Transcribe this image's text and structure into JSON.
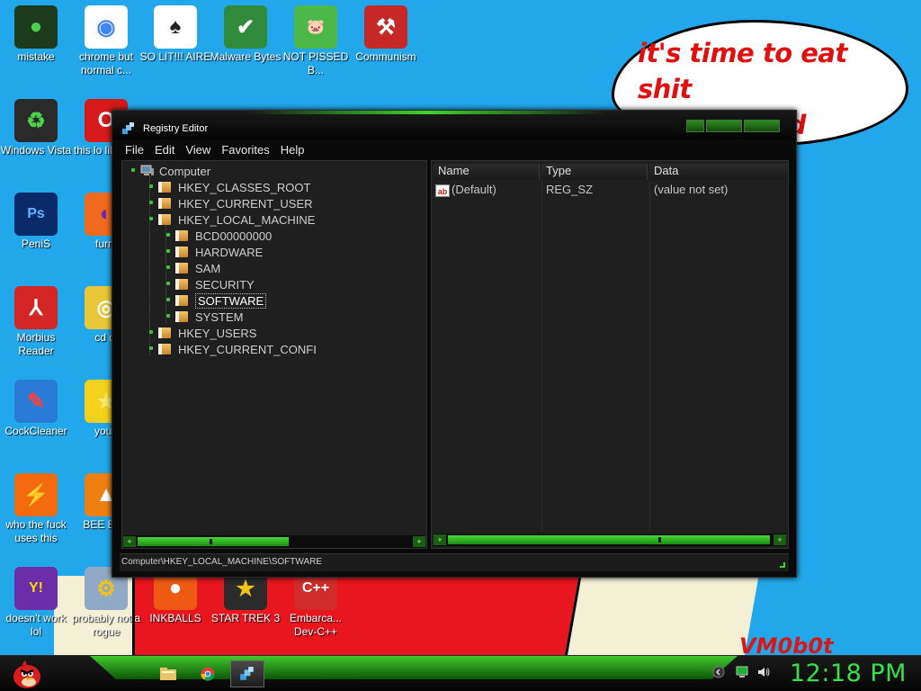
{
  "wallpaper": {
    "speech_bubble": [
      "it's time to eat shit",
      "and die and chew"
    ],
    "watermark": "VM0b0t"
  },
  "desktop_icons": [
    {
      "label": "mistake",
      "icon": "green-orb-icon"
    },
    {
      "label": "chrome but normal c...",
      "icon": "chrome-icon"
    },
    {
      "label": "SO LIT!!! AIRE",
      "icon": "playing-cards-icon"
    },
    {
      "label": "Malware Bytes",
      "icon": "shield-check-icon"
    },
    {
      "label": "NOT PISSED B...",
      "icon": "angry-bird-pig-icon"
    },
    {
      "label": "Communism",
      "icon": "emblem-icon"
    },
    {
      "label": "Windows Vista",
      "icon": "recycle-icon"
    },
    {
      "label": "this lo like a v",
      "icon": "opera-icon"
    },
    {
      "label": "PeniS",
      "icon": "photoshop-icon"
    },
    {
      "label": "furry",
      "icon": "firefox-icon"
    },
    {
      "label": "Morbius Reader",
      "icon": "pdf-reader-icon"
    },
    {
      "label": "cd di",
      "icon": "cd-icon"
    },
    {
      "label": "CockCleaner",
      "icon": "ccleaner-icon"
    },
    {
      "label": "you t",
      "icon": "star-icon"
    },
    {
      "label": "who the fuck uses this",
      "icon": "lightning-icon"
    },
    {
      "label": "BEE BEE",
      "icon": "vlc-cone-icon"
    },
    {
      "label": "doesn't work lol",
      "icon": "yahoo-messenger-icon"
    },
    {
      "label": "probably not a rogue",
      "icon": "gear-monitor-icon"
    },
    {
      "label": "INKBALLS",
      "icon": "inkball-icon"
    },
    {
      "label": "STAR TREK 3",
      "icon": "star-wars-icon"
    },
    {
      "label": "Embarca... Dev-C++",
      "icon": "devcpp-icon"
    }
  ],
  "window": {
    "title": "Registry Editor",
    "menu": [
      "File",
      "Edit",
      "View",
      "Favorites",
      "Help"
    ],
    "tree": {
      "root": "Computer",
      "hives": [
        "HKEY_CLASSES_ROOT",
        "HKEY_CURRENT_USER",
        "HKEY_LOCAL_MACHINE"
      ],
      "hklm_children": [
        "BCD00000000",
        "HARDWARE",
        "SAM",
        "SECURITY",
        "SOFTWARE",
        "SYSTEM"
      ],
      "selected": "SOFTWARE",
      "trailing_hives": [
        "HKEY_USERS",
        "HKEY_CURRENT_CONFI"
      ]
    },
    "columns": [
      "Name",
      "Type",
      "Data"
    ],
    "values": [
      {
        "name": "(Default)",
        "type": "REG_SZ",
        "data": "(value not set)",
        "icon": "ab-string-icon"
      }
    ],
    "status_path": "Computer\\HKEY_LOCAL_MACHINE\\SOFTWARE"
  },
  "taskbar": {
    "start_icon": "angry-bird-start-icon",
    "apps": [
      {
        "name": "explorer",
        "icon": "folder-icon"
      },
      {
        "name": "chrome",
        "icon": "chrome-icon"
      },
      {
        "name": "regedit",
        "icon": "regedit-icon",
        "active": true
      }
    ],
    "tray_icons": [
      "back-arrow-icon",
      "network-monitor-icon",
      "speaker-icon"
    ],
    "clock": "12:18 PM"
  },
  "colors": {
    "accent_green": "#3cd629",
    "clock_green": "#37e04b",
    "desktop_blue": "#22a7ea",
    "bubble_text": "#e01010"
  }
}
